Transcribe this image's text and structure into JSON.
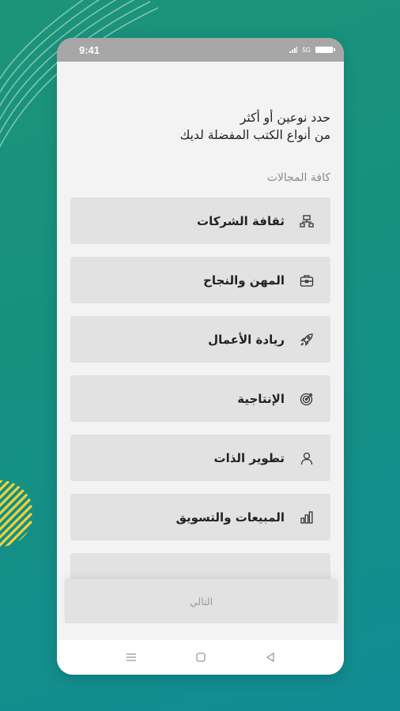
{
  "status_bar": {
    "time": "9:41",
    "network": "5G"
  },
  "header": {
    "line1": "حدد نوعين أو أكثر",
    "line2": "من أنواع الكتب المفضلة لديك"
  },
  "section_label": "كافة المجالات",
  "categories": [
    {
      "label": "ثقافة الشركات",
      "icon": "organization-icon"
    },
    {
      "label": "المهن والنجاح",
      "icon": "briefcase-icon"
    },
    {
      "label": "ريادة الأعمال",
      "icon": "rocket-icon"
    },
    {
      "label": "الإنتاجية",
      "icon": "target-icon"
    },
    {
      "label": "تطوير الذات",
      "icon": "person-icon"
    },
    {
      "label": "المبيعات والتسويق",
      "icon": "bar-chart-icon"
    }
  ],
  "next_button": {
    "label": "التالي"
  },
  "nav": {
    "items": [
      "menu-icon",
      "home-square-icon",
      "back-triangle-icon"
    ]
  },
  "colors": {
    "background_teal": "#16917f",
    "accent_yellow": "#f3d33a",
    "status_bar_gray": "#a7a7a7",
    "card_gray": "#e2e2e2"
  }
}
